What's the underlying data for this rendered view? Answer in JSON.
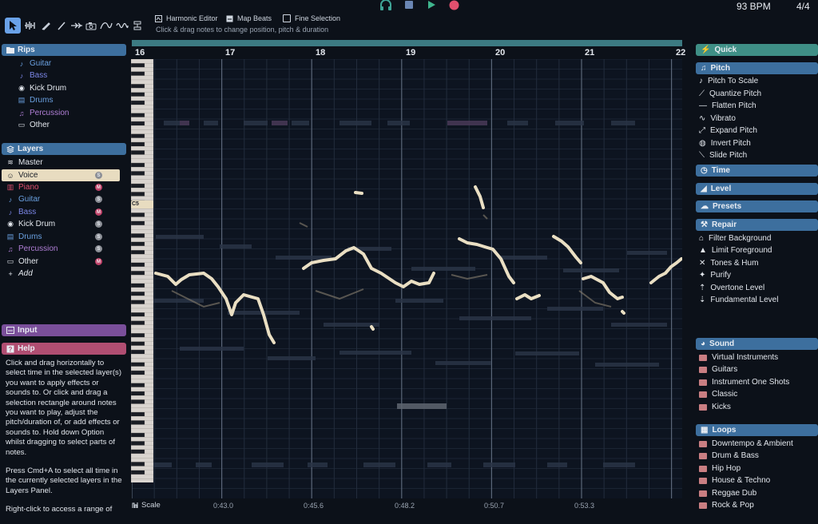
{
  "toolbar": {
    "toggles": [
      {
        "label": "Harmonic Editor"
      },
      {
        "label": "Map Beats"
      },
      {
        "label": "Fine Selection"
      }
    ],
    "hint": "Click & drag notes to change position, pitch & duration",
    "bpm": "93 BPM",
    "time_signature": "4/4"
  },
  "rips": {
    "title": "Rips",
    "items": [
      {
        "label": "Guitar",
        "color": "#6aa0e0"
      },
      {
        "label": "Bass",
        "color": "#7b86e6"
      },
      {
        "label": "Kick Drum",
        "color": "#e4e8ee"
      },
      {
        "label": "Drums",
        "color": "#6aa0e0"
      },
      {
        "label": "Percussion",
        "color": "#b07fd6"
      },
      {
        "label": "Other",
        "color": "#e4e8ee"
      }
    ]
  },
  "layers": {
    "title": "Layers",
    "items": [
      {
        "label": "Master",
        "badge": ""
      },
      {
        "label": "Voice",
        "badge": "S"
      },
      {
        "label": "Piano",
        "badge": "M"
      },
      {
        "label": "Guitar",
        "badge": "S"
      },
      {
        "label": "Bass",
        "badge": "M"
      },
      {
        "label": "Kick Drum",
        "badge": "S"
      },
      {
        "label": "Drums",
        "badge": "S"
      },
      {
        "label": "Percussion",
        "badge": "S"
      },
      {
        "label": "Other",
        "badge": "M"
      }
    ],
    "add_label": "Add"
  },
  "input": {
    "title": "Input"
  },
  "help": {
    "title": "Help",
    "p1": "Click and drag horizontally to select time in the selected layer(s) you want to apply effects or sounds to. Or click and drag a selection rectangle around notes you want to play, adjust the pitch/duration of, or add effects or sounds to. Hold down Option whilst dragging to select parts of notes.",
    "p2": "Press Cmd+A to select all time in the currently selected layers in the Layers Panel.",
    "p3": "Right-click to access a range of"
  },
  "editor": {
    "bars": [
      "16",
      "17",
      "18",
      "19",
      "20",
      "21",
      "22"
    ],
    "times": [
      "0:43.0",
      "0:45.6",
      "0:48.2",
      "0:50.7",
      "0:53.3"
    ],
    "scale_label": "Scale",
    "note_marker": "C5"
  },
  "right": {
    "quick": "Quick",
    "pitch": {
      "title": "Pitch",
      "items": [
        "Pitch To Scale",
        "Quantize Pitch",
        "Flatten Pitch",
        "Vibrato",
        "Expand Pitch",
        "Invert Pitch",
        "Slide Pitch"
      ]
    },
    "time": "Time",
    "level": "Level",
    "presets": "Presets",
    "repair": {
      "title": "Repair",
      "items": [
        "Filter Background",
        "Limit Foreground",
        "Tones & Hum",
        "Purify",
        "Overtone Level",
        "Fundamental Level"
      ]
    },
    "sound": {
      "title": "Sound",
      "items": [
        "Virtual Instruments",
        "Guitars",
        "Instrument One Shots",
        "Classic",
        "Kicks"
      ]
    },
    "loops": {
      "title": "Loops",
      "items": [
        "Downtempo & Ambient",
        "Drum & Bass",
        "Hip Hop",
        "House & Techno",
        "Reggae Dub",
        "Rock & Pop"
      ]
    }
  },
  "colors": {
    "rips_header": "#3d6f9e",
    "layers_header": "#3d6f9e",
    "input_header": "#7a4f9a",
    "help_header": "#b04e72",
    "quick": "#3f8f86",
    "pitch": "#3d6f9e",
    "time": "#3d6f9e",
    "level": "#3d6f9e",
    "presets": "#3d6f9e",
    "repair": "#3d6f9e",
    "sound": "#3d6f9e",
    "loops": "#3d6f9e",
    "active_layer": "#e8dcc0"
  }
}
